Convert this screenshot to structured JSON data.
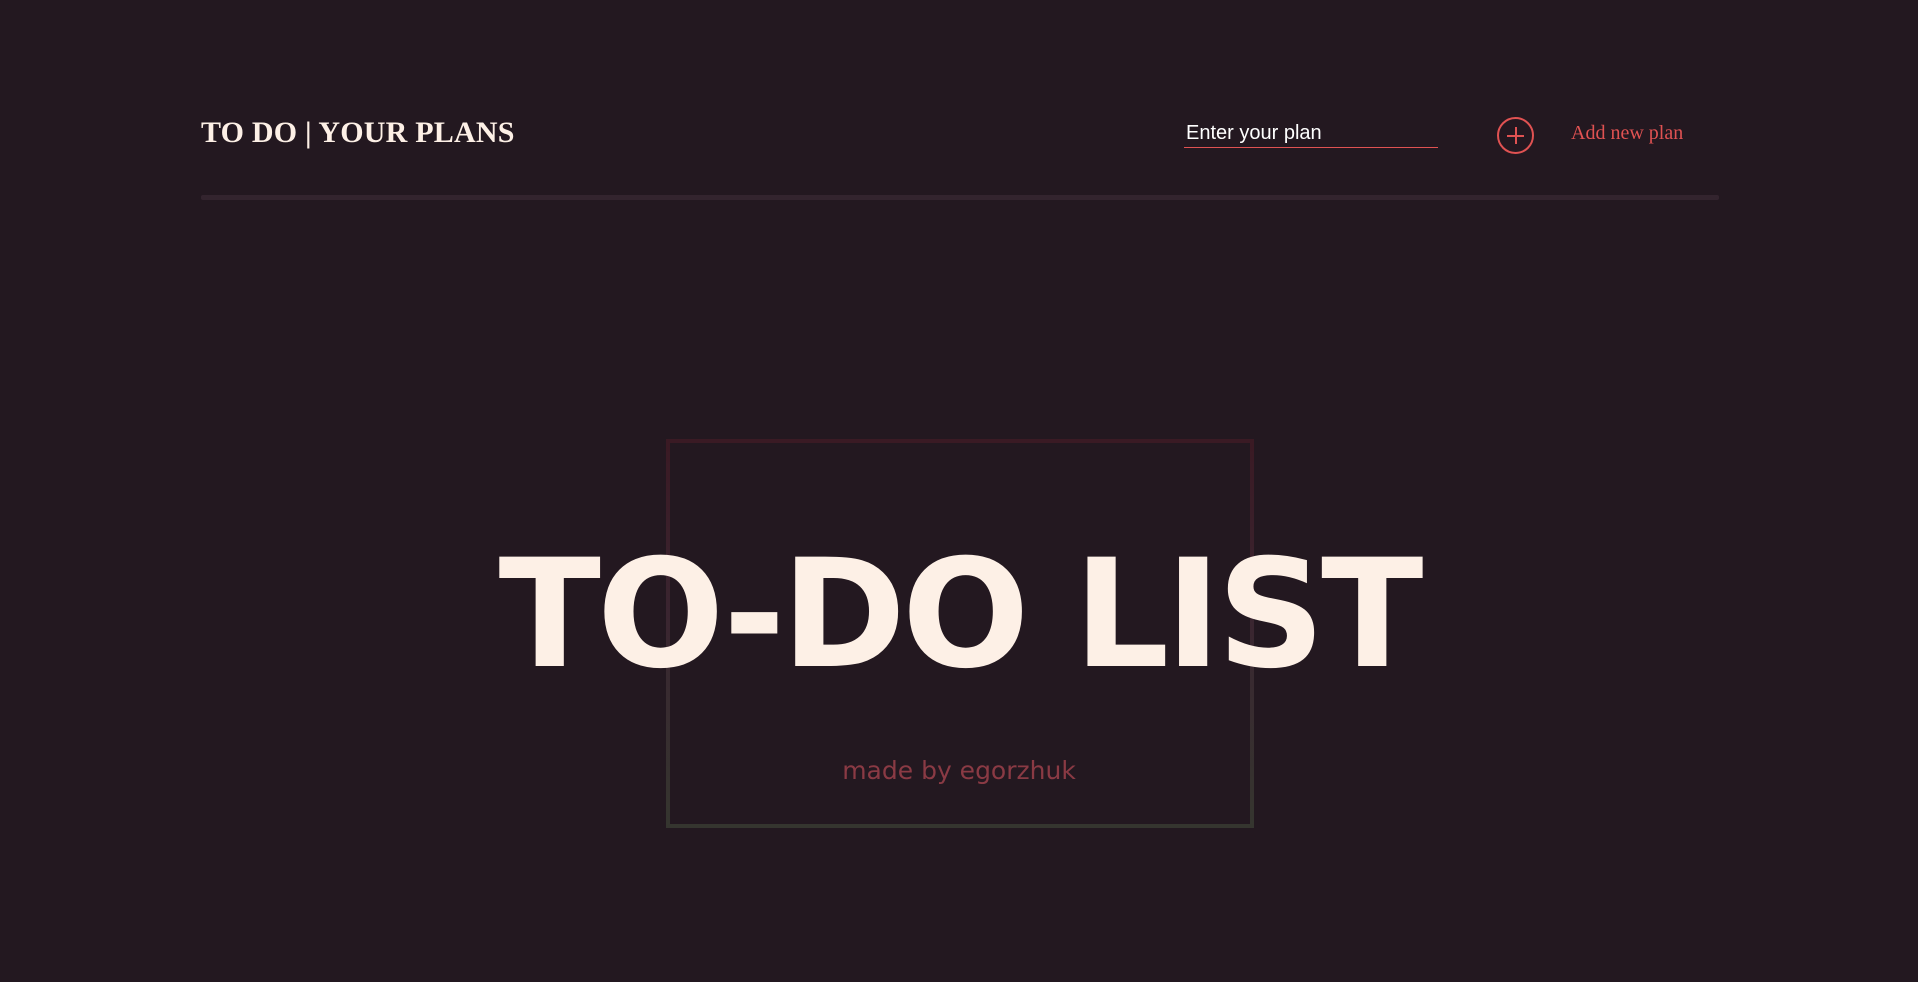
{
  "header": {
    "brand": "TO DO | YOUR PLANS",
    "input_placeholder": "Enter your plan",
    "add_label": "Add new plan"
  },
  "hero": {
    "title": "TO-DO LIST",
    "credit": "made by egorzhuk"
  },
  "colors": {
    "background": "#231820",
    "text": "#fdf0e6",
    "accent": "#e05252",
    "credit": "#8a3a44"
  },
  "icons": {
    "add": "plus-circle-icon"
  }
}
